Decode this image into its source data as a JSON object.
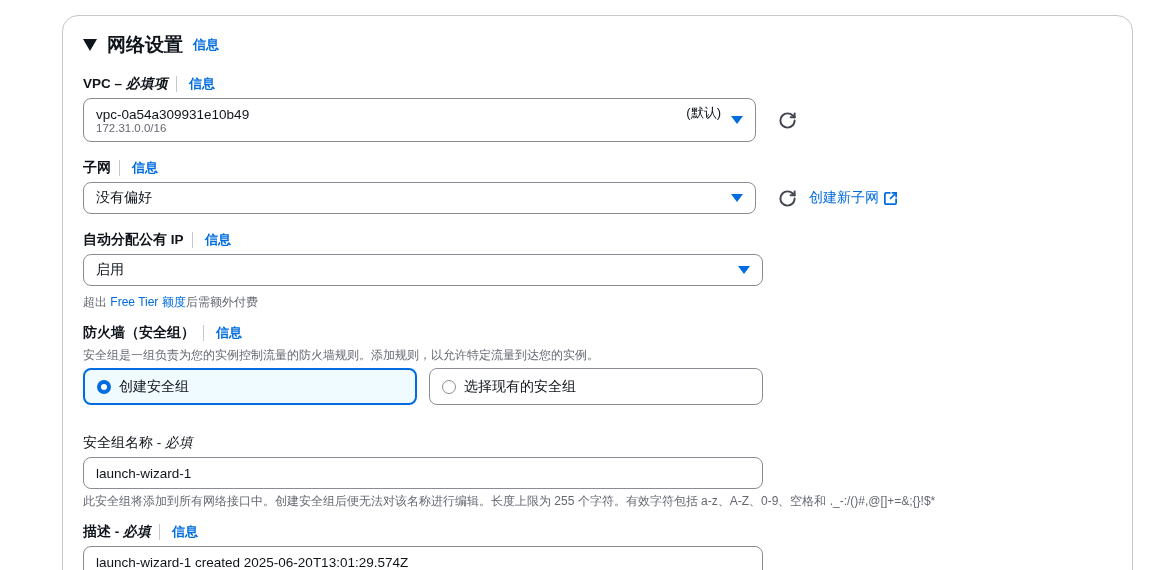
{
  "section": {
    "title": "网络设置",
    "info": "信息",
    "expanded": true
  },
  "vpc": {
    "label": "VPC – *必填项*",
    "info": "信息",
    "value": "vpc-0a54a309931e10b49",
    "detail": "172.31.0.0/16",
    "tag": "(默认)"
  },
  "subnet": {
    "label": "子网",
    "info": "信息",
    "value": "没有偏好",
    "link": "创建新子网"
  },
  "public_ip": {
    "label": "自动分配公有 IP",
    "info": "信息",
    "value": "启用",
    "hint_before": "超出 ",
    "hint_link": "Free Tier 额度",
    "hint_after": "后需额外付费"
  },
  "firewall": {
    "label": "防火墙（安全组）",
    "info": "信息",
    "description": "安全组是一组负责为您的实例控制流量的防火墙规则。添加规则，以允许特定流量到达您的实例。",
    "options": [
      {
        "label": "创建安全组",
        "selected": true
      },
      {
        "label": "选择现有的安全组",
        "selected": false
      }
    ]
  },
  "group_name": {
    "label": "安全组名称 - *必填*",
    "value": "launch-wizard-1",
    "hint": "此安全组将添加到所有网络接口中。创建安全组后便无法对该名称进行编辑。长度上限为 255 个字符。有效字符包括 a-z、A-Z、0-9、空格和 ._-:/()#,@[]+=&;{}!$*"
  },
  "description": {
    "label": "描述 - *必填*",
    "info": "信息",
    "value": "launch-wizard-1 created 2025-06-20T13:01:29.574Z"
  }
}
